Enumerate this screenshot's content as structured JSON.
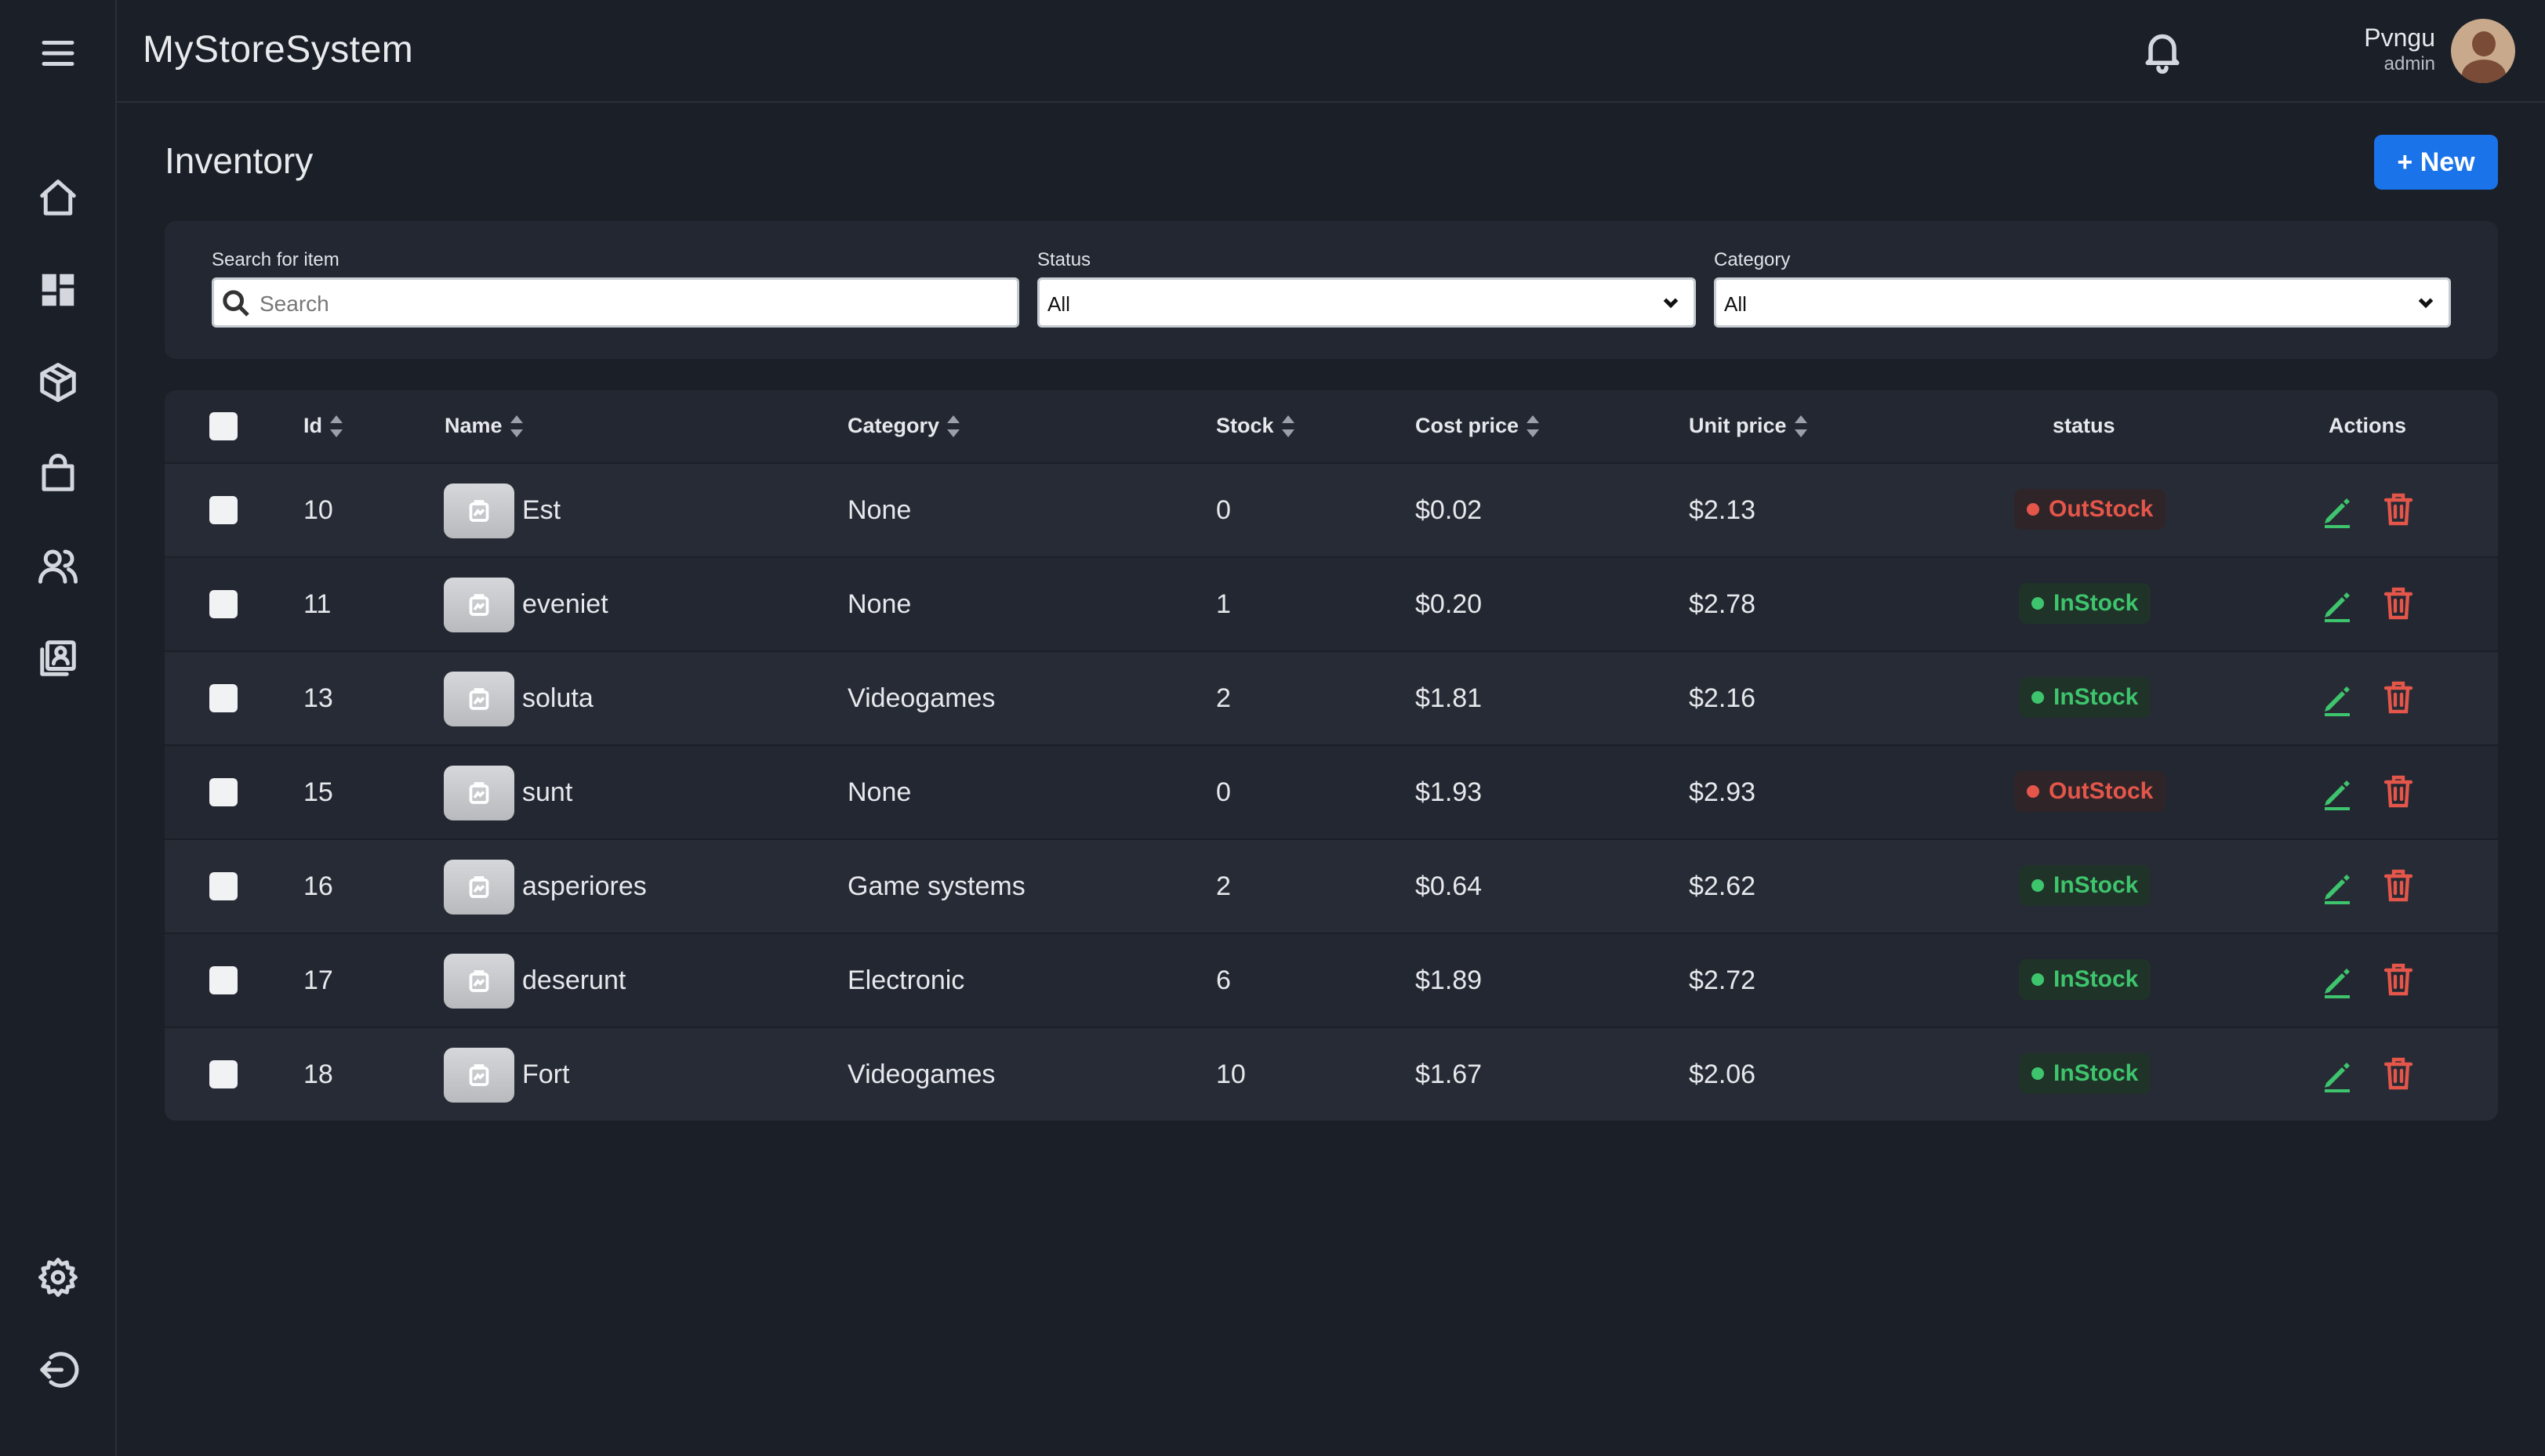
{
  "app": {
    "title": "MyStoreSystem"
  },
  "user": {
    "name": "Pvngu",
    "role": "admin"
  },
  "page": {
    "title": "Inventory",
    "new_label": "+ New"
  },
  "filters": {
    "search_label": "Search for item",
    "search_placeholder": "Search",
    "status_label": "Status",
    "status_value": "All",
    "category_label": "Category",
    "category_value": "All"
  },
  "table": {
    "headers": {
      "id": "Id",
      "name": "Name",
      "category": "Category",
      "stock": "Stock",
      "cost": "Cost price",
      "unit": "Unit price",
      "status": "status",
      "actions": "Actions"
    },
    "rows": [
      {
        "id": "10",
        "name": "Est",
        "category": "None",
        "stock": "0",
        "cost": "$0.02",
        "unit": "$2.13",
        "status": "OutStock"
      },
      {
        "id": "11",
        "name": "eveniet",
        "category": "None",
        "stock": "1",
        "cost": "$0.20",
        "unit": "$2.78",
        "status": "InStock"
      },
      {
        "id": "13",
        "name": "soluta",
        "category": "Videogames",
        "stock": "2",
        "cost": "$1.81",
        "unit": "$2.16",
        "status": "InStock"
      },
      {
        "id": "15",
        "name": "sunt",
        "category": "None",
        "stock": "0",
        "cost": "$1.93",
        "unit": "$2.93",
        "status": "OutStock"
      },
      {
        "id": "16",
        "name": "asperiores",
        "category": "Game systems",
        "stock": "2",
        "cost": "$0.64",
        "unit": "$2.62",
        "status": "InStock"
      },
      {
        "id": "17",
        "name": "deserunt",
        "category": "Electronic",
        "stock": "6",
        "cost": "$1.89",
        "unit": "$2.72",
        "status": "InStock"
      },
      {
        "id": "18",
        "name": "Fort",
        "category": "Videogames",
        "stock": "10",
        "cost": "$1.67",
        "unit": "$2.06",
        "status": "InStock"
      }
    ]
  },
  "colors": {
    "accent": "#1a73e8",
    "instock": "#3ec46d",
    "outstock": "#e5564a",
    "edit": "#3ec46d",
    "delete": "#e5564a"
  }
}
